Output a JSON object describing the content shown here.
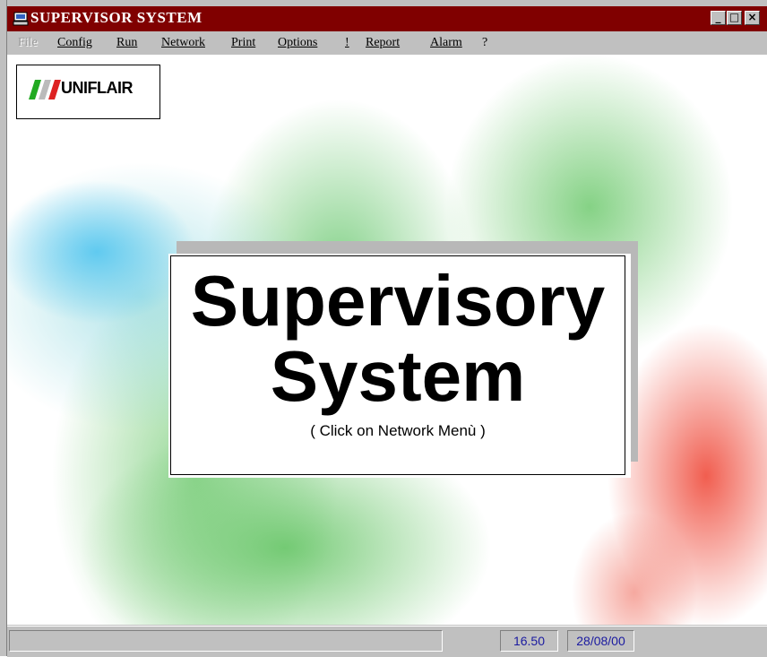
{
  "window": {
    "title": "SUPERVISOR SYSTEM",
    "controls": {
      "minimize": "_",
      "maximize": "□",
      "close": "×"
    }
  },
  "menu": {
    "items": [
      {
        "label": "File",
        "enabled": false
      },
      {
        "label": "Config",
        "enabled": true
      },
      {
        "label": "Run",
        "enabled": true
      },
      {
        "label": "Network",
        "enabled": true
      },
      {
        "label": "Print",
        "enabled": true
      },
      {
        "label": "Options",
        "enabled": true
      },
      {
        "label": "!",
        "enabled": true
      },
      {
        "label": "Report",
        "enabled": true
      },
      {
        "label": "Alarm",
        "enabled": true
      },
      {
        "label": "?",
        "enabled": true
      }
    ]
  },
  "logo": {
    "text": "UNIFLAIR",
    "colors": [
      "#22aa22",
      "#bbbbbb",
      "#dd2222"
    ]
  },
  "splash": {
    "line1": "Supervisory",
    "line2": "System",
    "hint": "( Click on Network Menù )"
  },
  "status": {
    "message": "",
    "time": "16.50",
    "date": "28/08/00"
  },
  "colors": {
    "titlebar": "#800000",
    "chrome": "#c0c0c0",
    "status_text": "#1a1aa0"
  }
}
